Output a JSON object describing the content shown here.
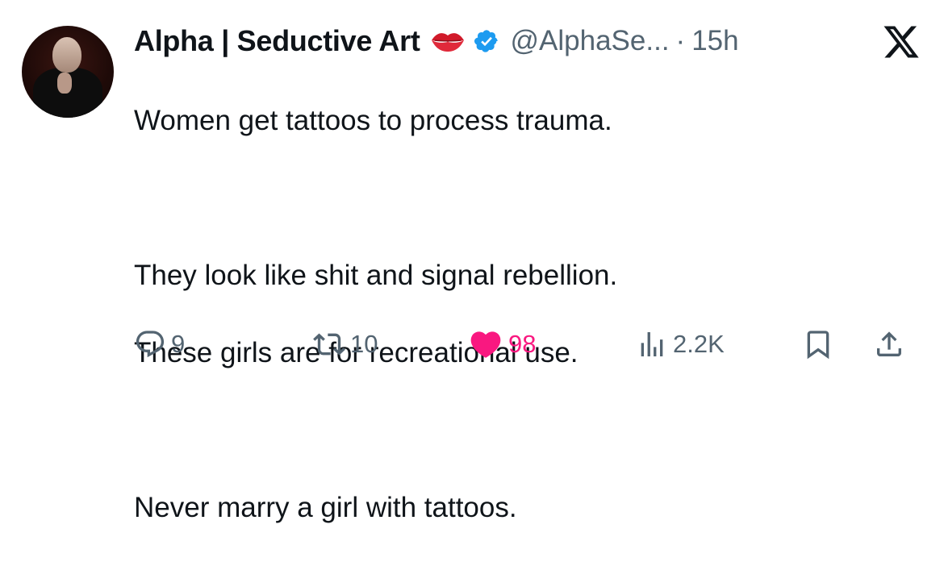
{
  "author": {
    "name": "Alpha | Seductive Art",
    "handle": "@AlphaSe...",
    "time": "15h",
    "separator": "·",
    "badge": "verified-badge-icon",
    "emoji": "kiss-mark-icon"
  },
  "tweet": {
    "lines": [
      "Women get tattoos to process trauma.",
      "",
      "They look like shit and signal rebellion.",
      "These girls are for recreational use.",
      "",
      "Never marry a girl with tattoos."
    ]
  },
  "actions": {
    "replies": "9",
    "reposts": "10",
    "likes": "98",
    "views": "2.2K"
  },
  "colors": {
    "text": "#0f1419",
    "muted": "#536471",
    "like": "#f91880",
    "verified": "#1d9bf0"
  }
}
